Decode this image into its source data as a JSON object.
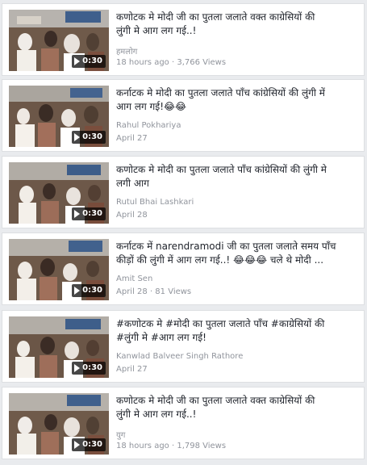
{
  "videos": [
    {
      "title_line1": "कणोटक मे मोदी जी का पुतला जलाते वक्त काग्रेसियों की",
      "title_line2": "लुंगी मे आग लग गई..!",
      "author": "हमलोग",
      "meta": "18 hours ago · 3,766 Views",
      "duration": "0:30"
    },
    {
      "title_line1": "कर्नाटक मे मोदी का पुतला जलाते पाँच कांग्रेसियों की लुंगी में",
      "title_line2": "आग लग गई!😂😂",
      "author": "Rahul Pokhariya",
      "meta": "April 27",
      "duration": "0:30"
    },
    {
      "title_line1": "कणोटक मे मोदी का पुतला जलाते पाँच कांग्रेसियों की लुंगी मे",
      "title_line2": "लगी आग",
      "author": "Rutul Bhai Lashkari",
      "meta": "April 28",
      "duration": "0:30"
    },
    {
      "title_line1": "कर्नाटक में narendramodi जी का पुतला जलाते समय पाँच",
      "title_line2": "कीड़ों की लुंगी में आग लग गई..! 😂😂😂 चले थे मोदी ...",
      "author": "Amit Sen",
      "meta": "April 28 · 81 Views",
      "duration": "0:30"
    },
    {
      "title_line1": "#कणोटक मे #मोदी का पुतला जलाते पाँच #काग्रेसियों की",
      "title_line2": "#लुंगी मे #आग लग गई!",
      "author": "Kanwlad Balveer Singh Rathore",
      "meta": "April 27",
      "duration": "0:30"
    },
    {
      "title_line1": "कणोटक मे मोदी जी का पुतला जलाते वक्त काग्रेसियों की",
      "title_line2": "लुंगी मे आग लग गई..!",
      "author": "युग",
      "meta": "18 hours ago · 1,798 Views",
      "duration": "0:30"
    }
  ]
}
